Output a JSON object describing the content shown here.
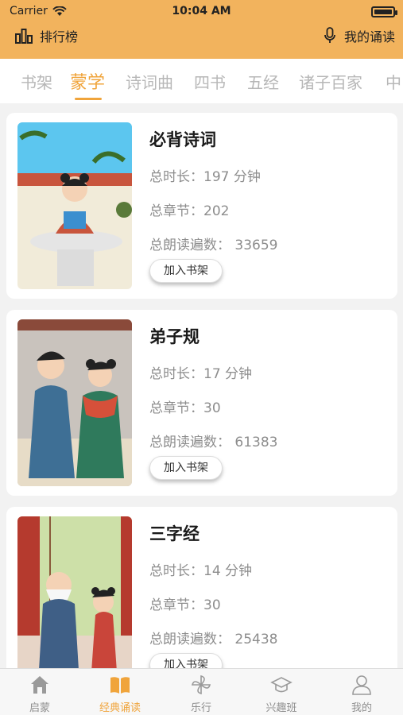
{
  "status": {
    "carrier": "Carrier",
    "time": "10:04 AM"
  },
  "nav": {
    "ranking_label": "排行榜",
    "my_reading_label": "我的诵读"
  },
  "tabs": [
    "书架",
    "蒙学",
    "诗词曲",
    "四书",
    "五经",
    "诸子百家",
    "中"
  ],
  "books": [
    {
      "title": "必背诗词",
      "duration": "总时长：197 分钟",
      "chapters": "总章节：202",
      "reads": "总朗读遍数： 33659",
      "button": "加入书架"
    },
    {
      "title": "弟子规",
      "duration": "总时长：17 分钟",
      "chapters": "总章节：30",
      "reads": "总朗读遍数： 61383",
      "button": "加入书架"
    },
    {
      "title": "三字经",
      "duration": "总时长：14 分钟",
      "chapters": "总章节：30",
      "reads": "总朗读遍数： 25438",
      "button": "加入书架"
    }
  ],
  "tabbar": [
    {
      "label": "启蒙",
      "icon": "house-icon"
    },
    {
      "label": "经典诵读",
      "icon": "book-icon"
    },
    {
      "label": "乐行",
      "icon": "pinwheel-icon"
    },
    {
      "label": "兴趣班",
      "icon": "graduation-cap-icon"
    },
    {
      "label": "我的",
      "icon": "user-icon"
    }
  ],
  "colors": {
    "header": "#f2b35d",
    "accent": "#f0a43b",
    "inactive": "#b7b7b7"
  }
}
